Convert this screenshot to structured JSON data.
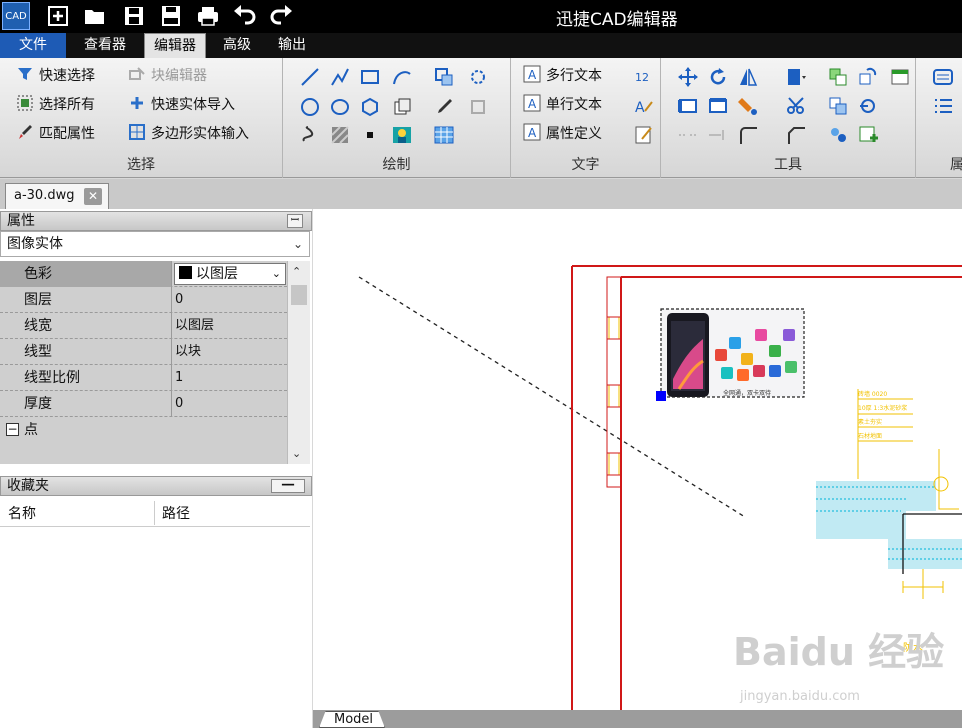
{
  "app": {
    "logo_text": "CAD",
    "title": "迅捷CAD编辑器"
  },
  "menu": {
    "file": "文件",
    "viewer": "查看器",
    "editor": "编辑器",
    "advanced": "高级",
    "output": "输出"
  },
  "ribbon": {
    "select_group": {
      "label": "选择",
      "quick_select": "快速选择",
      "block_editor": "块编辑器",
      "select_all": "选择所有",
      "quick_entity_import": "快速实体导入",
      "match_properties": "匹配属性",
      "polygon_entity_input": "多边形实体输入"
    },
    "draw_group": {
      "label": "绘制"
    },
    "text_group": {
      "label": "文字",
      "mtext": "多行文本",
      "single_text": "单行文本",
      "attr_def": "属性定义"
    },
    "tools_group": {
      "label": "工具"
    },
    "properties_group": {
      "label": "属"
    }
  },
  "doc_tab": {
    "name": "a-30.dwg",
    "close": "✕"
  },
  "properties_panel": {
    "title": "属性",
    "pin": "ꟷ",
    "entity_type": "图像实体",
    "rows": [
      {
        "name": "色彩",
        "value": "以图层"
      },
      {
        "name": "图层",
        "value": "0"
      },
      {
        "name": "线宽",
        "value": "以图层"
      },
      {
        "name": "线型",
        "value": "以块"
      },
      {
        "name": "线型比例",
        "value": "1"
      },
      {
        "name": "厚度",
        "value": "0"
      }
    ],
    "section": "点",
    "section_toggle": "−"
  },
  "favorites_panel": {
    "title": "收藏夹",
    "col_name": "名称",
    "col_path": "路径"
  },
  "canvas": {
    "model_tab": "Model",
    "image_caption": "全网通，双卡双待",
    "watermark": "Baidu 经验",
    "watermark_url": "jingyan.baidu.com",
    "cad_labels": [
      "砖墙 0020",
      "10厚 1:3水泥砂浆",
      "素土夯实",
      "石材地面",
      "防水"
    ]
  },
  "colors": {
    "accent": "#1e5bb5",
    "frame_red": "#d01818",
    "cad_yellow": "#f2c200",
    "cad_cyan": "#00b4d8",
    "selection_grip": "#0000ff"
  }
}
